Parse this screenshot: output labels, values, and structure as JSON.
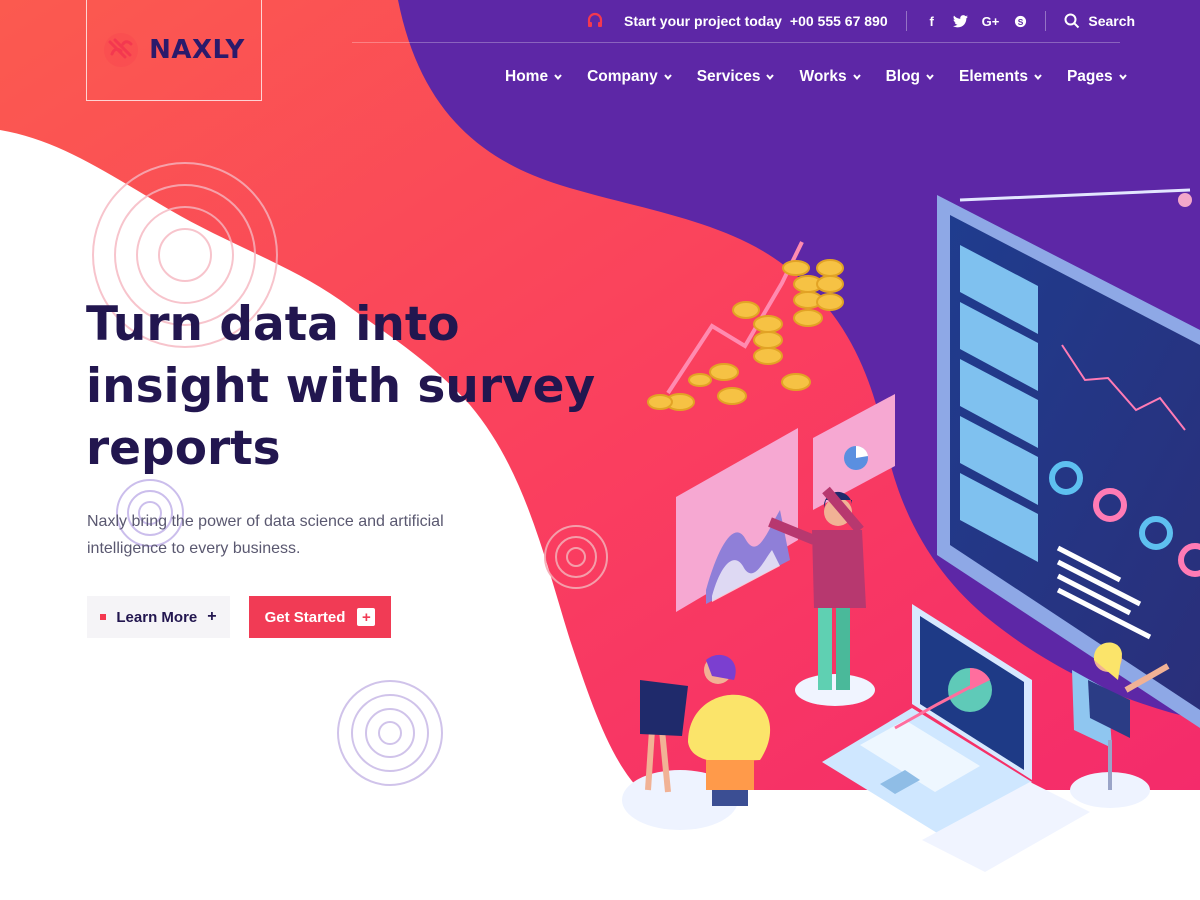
{
  "brand": {
    "name": "NAXLY",
    "accent": "#f4384f",
    "navy": "#22164f",
    "purple": "#5f2aa8"
  },
  "topbar": {
    "cta_text": "Start your project today",
    "phone": "+00 555 67 890",
    "social": [
      "f",
      "t",
      "G+",
      "S"
    ],
    "search_label": "Search"
  },
  "nav": [
    {
      "label": "Home"
    },
    {
      "label": "Company"
    },
    {
      "label": "Services"
    },
    {
      "label": "Works"
    },
    {
      "label": "Blog"
    },
    {
      "label": "Elements"
    },
    {
      "label": "Pages"
    }
  ],
  "hero": {
    "title_lines": [
      "Turn data into",
      "insight with survey",
      "reports"
    ],
    "subtitle": "Naxly bring the power of data science and artificial intelligence to every business.",
    "btn_learn": "Learn More",
    "btn_start": "Get Started"
  }
}
